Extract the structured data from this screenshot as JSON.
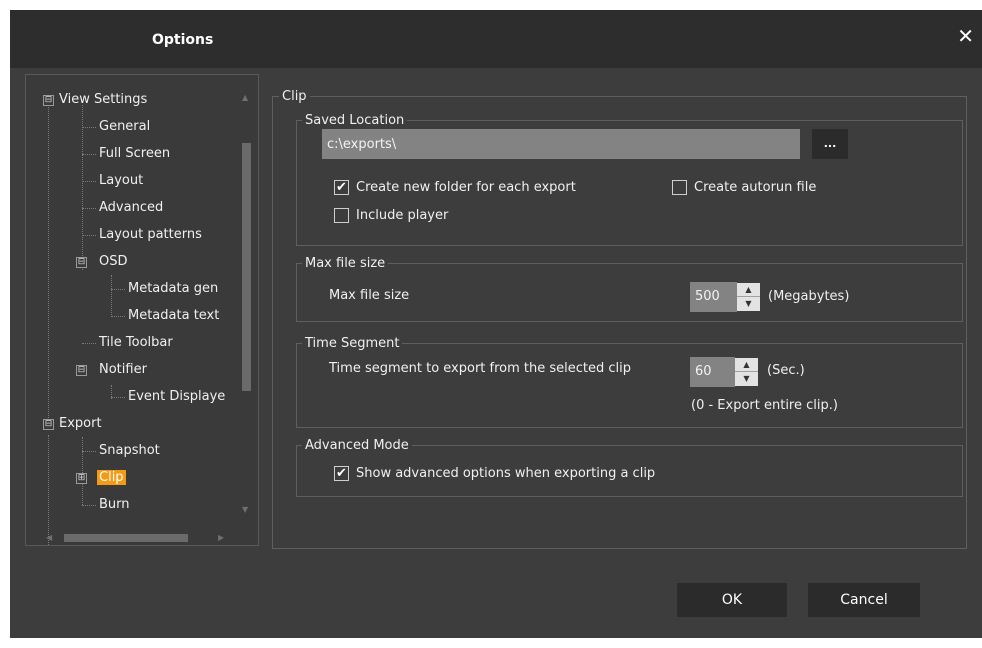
{
  "window": {
    "title": "Options",
    "close_glyph": "✕"
  },
  "tree": {
    "items": [
      {
        "label": "View Settings",
        "expander": "⊟"
      },
      {
        "label": "General"
      },
      {
        "label": "Full Screen"
      },
      {
        "label": "Layout"
      },
      {
        "label": "Advanced"
      },
      {
        "label": "Layout patterns"
      },
      {
        "label": "OSD",
        "expander": "⊟"
      },
      {
        "label": "Metadata gen"
      },
      {
        "label": "Metadata text"
      },
      {
        "label": "Tile Toolbar"
      },
      {
        "label": "Notifier",
        "expander": "⊟"
      },
      {
        "label": "Event Displaye"
      },
      {
        "label": "Export",
        "expander": "⊟"
      },
      {
        "label": "Snapshot"
      },
      {
        "label": "Clip",
        "expander": "⊞",
        "selected": true
      },
      {
        "label": "Burn"
      }
    ]
  },
  "clip": {
    "group_title": "Clip",
    "saved_location": {
      "title": "Saved Location",
      "path": "c:\\exports\\",
      "browse_label": "...",
      "create_folder_label": "Create new folder for each export",
      "create_folder_checked": true,
      "create_autorun_label": "Create autorun file",
      "create_autorun_checked": false,
      "include_player_label": "Include player",
      "include_player_checked": false
    },
    "max_file_size": {
      "title": "Max file size",
      "label": "Max file size",
      "value": "500",
      "unit": "(Megabytes)"
    },
    "time_segment": {
      "title": "Time Segment",
      "label": "Time segment to export from the selected clip",
      "value": "60",
      "unit": "(Sec.)",
      "note": "(0 - Export entire clip.)"
    },
    "advanced_mode": {
      "title": "Advanced Mode",
      "label": "Show advanced options when exporting a clip",
      "checked": true
    }
  },
  "footer": {
    "ok_label": "OK",
    "cancel_label": "Cancel"
  },
  "colors": {
    "background": "#3d3d3d",
    "titlebar": "#2d2d2d",
    "accent": "#f59a14",
    "input": "#838383",
    "button": "#2b2b2b"
  }
}
